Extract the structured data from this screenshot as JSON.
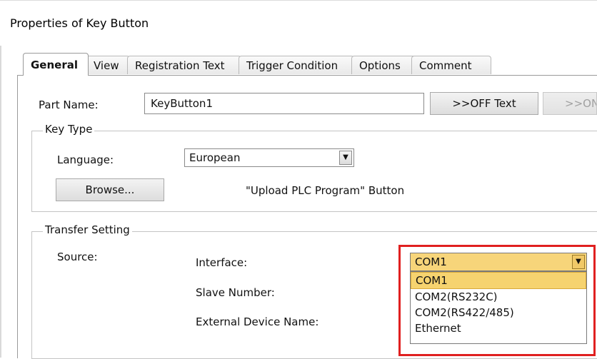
{
  "window": {
    "title": "Properties of Key Button"
  },
  "tabs": [
    {
      "label": "General",
      "active": true
    },
    {
      "label": "View",
      "active": false
    },
    {
      "label": "Registration Text",
      "active": false
    },
    {
      "label": "Trigger Condition",
      "active": false
    },
    {
      "label": "Options",
      "active": false
    },
    {
      "label": "Comment",
      "active": false
    }
  ],
  "general": {
    "part_name_label": "Part Name:",
    "part_name_value": "KeyButton1",
    "off_text_button": ">>OFF Text",
    "on_text_button": ">>ON",
    "key_type": {
      "legend": "Key Type",
      "language_label": "Language:",
      "language_value": "European",
      "browse_button": "Browse...",
      "description": "\"Upload PLC Program\"  Button"
    },
    "transfer": {
      "legend": "Transfer Setting",
      "source_label": "Source:",
      "interface_label": "Interface:",
      "slave_number_label": "Slave Number:",
      "external_device_label": "External Device Name:",
      "interface_value": "COM1",
      "interface_options": [
        "COM1",
        "COM2(RS232C)",
        "COM2(RS422/485)",
        "Ethernet"
      ],
      "selected_option": "COM1"
    }
  },
  "colors": {
    "highlight": "#f6d36f",
    "annotation_box": "#e02020"
  }
}
